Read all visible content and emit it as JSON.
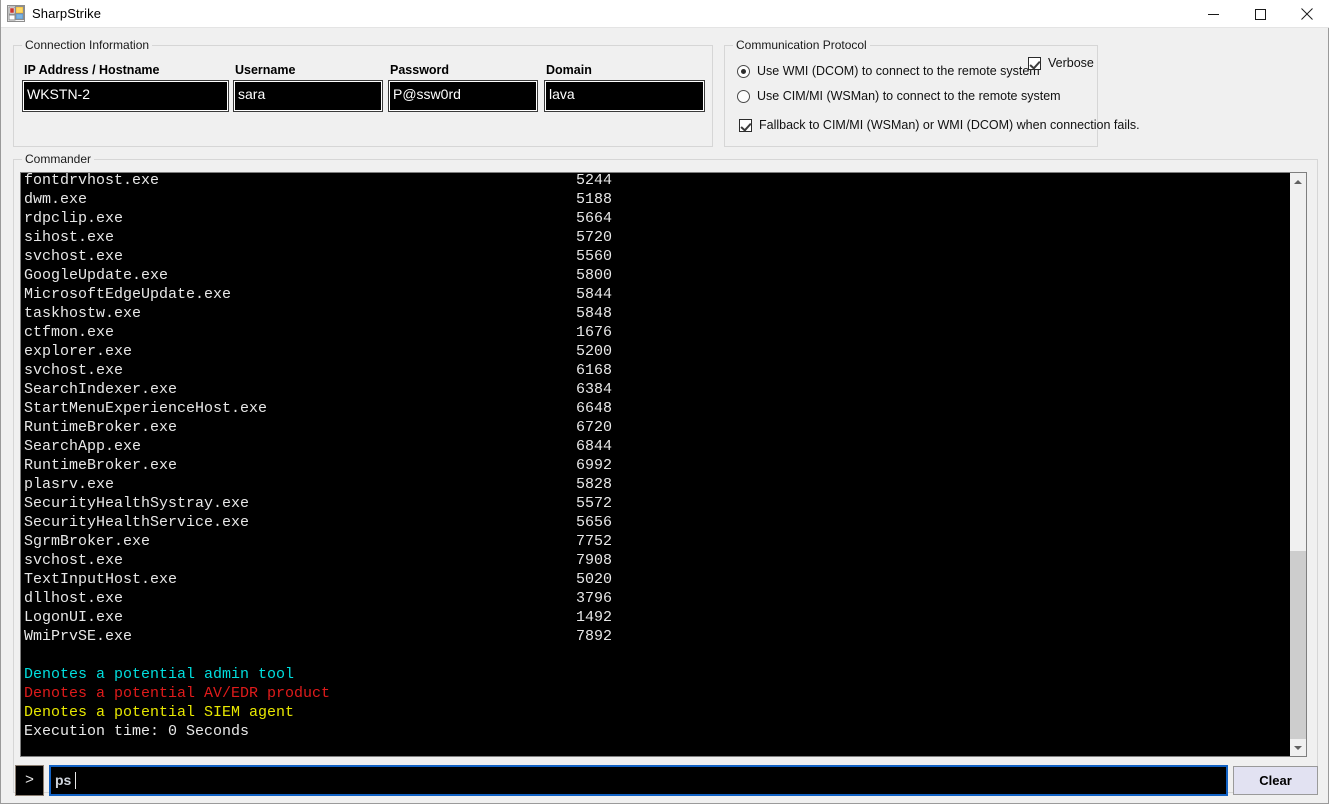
{
  "window": {
    "title": "SharpStrike",
    "icon": "winforms-app-icon",
    "controls": {
      "minimize": "minimize-icon",
      "maximize": "maximize-icon",
      "close": "close-icon"
    }
  },
  "connection": {
    "group_label": "Connection Information",
    "fields": [
      {
        "label": "IP Address / Hostname",
        "value": "WKSTN-2",
        "placeholder": ""
      },
      {
        "label": "Username",
        "value": "sara",
        "placeholder": ""
      },
      {
        "label": "Password",
        "value": "P@ssw0rd",
        "placeholder": ""
      },
      {
        "label": "Domain",
        "value": "lava",
        "placeholder": ""
      }
    ]
  },
  "protocol": {
    "group_label": "Communication Protocol",
    "radios": [
      {
        "label": "Use WMI (DCOM) to connect to the remote system",
        "checked": true
      },
      {
        "label": "Use CIM/MI (WSMan) to connect to the remote system",
        "checked": false
      }
    ],
    "verbose": {
      "label": "Verbose",
      "checked": true
    },
    "fallback": {
      "label": "Fallback to CIM/MI (WSMan) or WMI (DCOM) when connection fails.",
      "checked": true
    }
  },
  "commander": {
    "group_label": "Commander",
    "processes": [
      {
        "name": "fontdrvhost.exe",
        "pid": "5244"
      },
      {
        "name": "dwm.exe",
        "pid": "5188"
      },
      {
        "name": "rdpclip.exe",
        "pid": "5664"
      },
      {
        "name": "sihost.exe",
        "pid": "5720"
      },
      {
        "name": "svchost.exe",
        "pid": "5560"
      },
      {
        "name": "GoogleUpdate.exe",
        "pid": "5800"
      },
      {
        "name": "MicrosoftEdgeUpdate.exe",
        "pid": "5844"
      },
      {
        "name": "taskhostw.exe",
        "pid": "5848"
      },
      {
        "name": "ctfmon.exe",
        "pid": "1676"
      },
      {
        "name": "explorer.exe",
        "pid": "5200"
      },
      {
        "name": "svchost.exe",
        "pid": "6168"
      },
      {
        "name": "SearchIndexer.exe",
        "pid": "6384"
      },
      {
        "name": "StartMenuExperienceHost.exe",
        "pid": "6648"
      },
      {
        "name": "RuntimeBroker.exe",
        "pid": "6720"
      },
      {
        "name": "SearchApp.exe",
        "pid": "6844"
      },
      {
        "name": "RuntimeBroker.exe",
        "pid": "6992"
      },
      {
        "name": "plasrv.exe",
        "pid": "5828"
      },
      {
        "name": "SecurityHealthSystray.exe",
        "pid": "5572"
      },
      {
        "name": "SecurityHealthService.exe",
        "pid": "5656"
      },
      {
        "name": "SgrmBroker.exe",
        "pid": "7752"
      },
      {
        "name": "svchost.exe",
        "pid": "7908"
      },
      {
        "name": "TextInputHost.exe",
        "pid": "5020"
      },
      {
        "name": "dllhost.exe",
        "pid": "3796"
      },
      {
        "name": "LogonUI.exe",
        "pid": "1492"
      },
      {
        "name": "WmiPrvSE.exe",
        "pid": "7892"
      }
    ],
    "legend": [
      {
        "text": "Denotes a potential admin tool",
        "color": "#00dede"
      },
      {
        "text": "Denotes a potential AV/EDR product",
        "color": "#e01b1b"
      },
      {
        "text": "Denotes a potential SIEM agent",
        "color": "#e8e800"
      }
    ],
    "execution_time": "Execution time: 0 Seconds"
  },
  "command_bar": {
    "prompt": ">",
    "input_value": "ps",
    "input_placeholder": "",
    "clear_label": "Clear"
  },
  "scrollbar": {
    "up_icon": "chevron-up-icon",
    "down_icon": "chevron-down-icon"
  },
  "colors": {
    "accent": "#1262c4",
    "console_bg": "#000000",
    "console_fg": "#e8e8e8",
    "window_bg": "#f0f0f0",
    "button_bg": "#e2e2f2"
  }
}
